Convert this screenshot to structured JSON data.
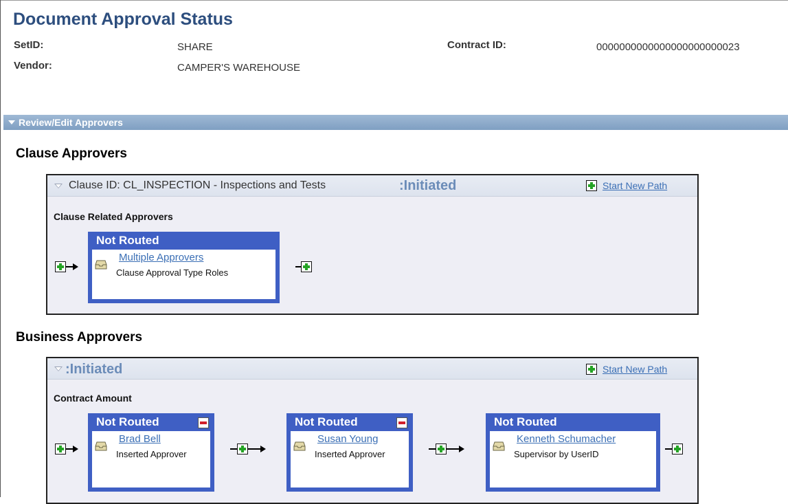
{
  "page": {
    "title": "Document Approval Status"
  },
  "fields": {
    "setid_label": "SetID:",
    "setid_value": "SHARE",
    "vendor_label": "Vendor:",
    "vendor_value": "CAMPER'S WAREHOUSE",
    "contract_label": "Contract ID:",
    "contract_value": "0000000000000000000000023"
  },
  "section": {
    "label": "Review/Edit Approvers"
  },
  "clause": {
    "heading": "Clause Approvers",
    "header_text": "Clause ID: CL_INSPECTION - Inspections and Tests",
    "status": ":Initiated",
    "start_new_path": "Start New Path",
    "row_label": "Clause Related Approvers",
    "stages": [
      {
        "status": "Not Routed",
        "approver": "Multiple Approvers",
        "role": "Clause Approval Type Roles"
      }
    ]
  },
  "business": {
    "heading": "Business Approvers",
    "status": ":Initiated",
    "start_new_path": "Start New Path",
    "row_label": "Contract Amount",
    "stages": [
      {
        "status": "Not Routed",
        "approver": "Brad Bell",
        "role": "Inserted Approver"
      },
      {
        "status": "Not Routed",
        "approver": "Susan Young",
        "role": "Inserted Approver"
      },
      {
        "status": "Not Routed",
        "approver": "Kenneth Schumacher",
        "role": "Supervisor by UserID"
      }
    ]
  },
  "icons": {
    "collapse": "triangle-down-icon",
    "add_step": "plus-icon",
    "remove_step": "minus-icon",
    "approver": "inbox-tray-icon"
  },
  "colors": {
    "title": "#2d4e7e",
    "section_bar": "#8aa8c9",
    "stage_blue": "#3f5fc4",
    "link": "#3b6fb5",
    "add": "#25a325",
    "remove": "#d11f2b"
  }
}
